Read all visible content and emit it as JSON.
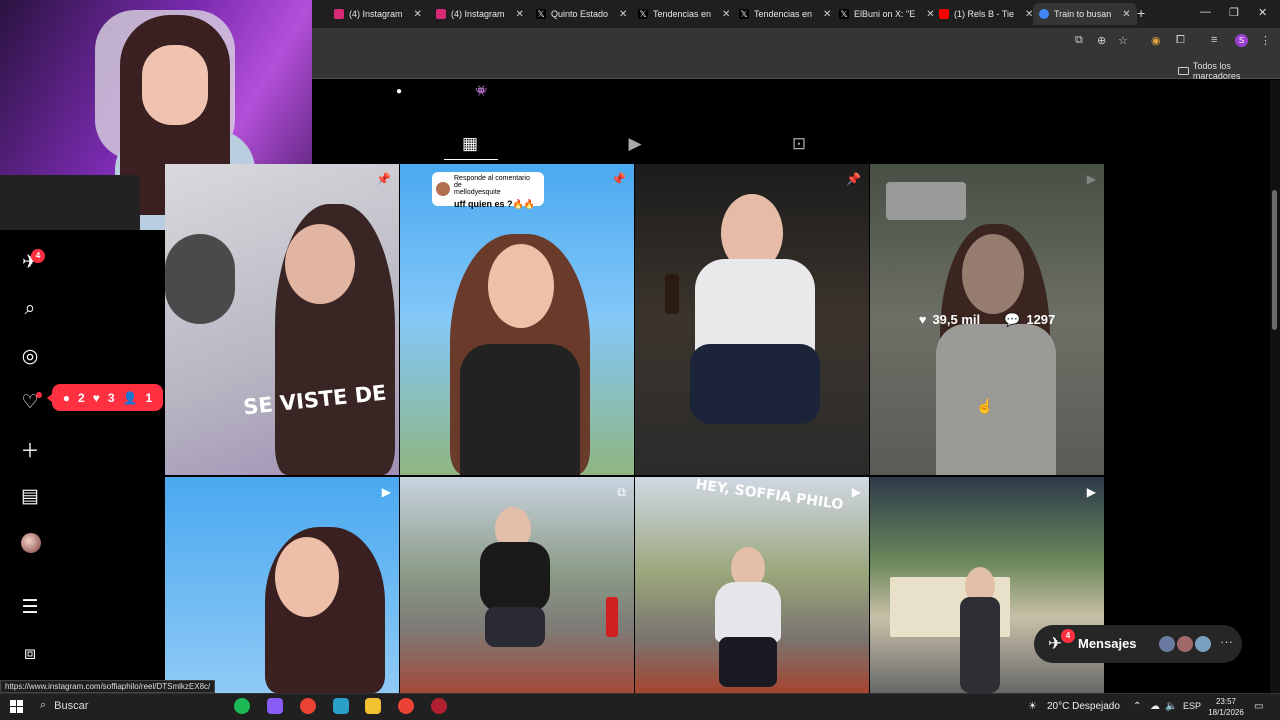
{
  "browser": {
    "tabs": [
      {
        "title": "(4) Instagram",
        "color": "#d62976"
      },
      {
        "title": "(4) Instagram",
        "color": "#d62976"
      },
      {
        "title": "Quinto Estado",
        "color": "#000000"
      },
      {
        "title": "Tendencias en",
        "color": "#000000"
      },
      {
        "title": "Tendencias en",
        "color": "#000000"
      },
      {
        "title": "ElBuni on X: \"E",
        "color": "#000000"
      },
      {
        "title": "(1) Rels B - Tie",
        "color": "#ff0000"
      },
      {
        "title": "Train to busan",
        "color": "#4285f4"
      }
    ],
    "bookmarks_all": "Todos los marcadores",
    "profile_initial": "S",
    "status_url": "https://www.instagram.com/soffiaphilo/reel/DTSmlkzEX8c/"
  },
  "nav": {
    "messages_badge": "4",
    "notifications": {
      "comments": "2",
      "likes": "3",
      "follows": "1"
    }
  },
  "grid": {
    "hover_stats": {
      "likes": "39,5 mil",
      "comments": "1297"
    },
    "comment_card": {
      "line1": "Responde al comentario de",
      "line2": "mellodyesquite",
      "text": "uff quien es ?🔥🔥"
    },
    "caption_1": "SE VISTE DE",
    "caption_2": "HEY, SOFFIA PHILO"
  },
  "messages": {
    "label": "Mensajes",
    "badge": "4"
  },
  "taskbar": {
    "search": "Buscar",
    "weather": "20°C  Despejado",
    "lang": "ESP",
    "time": "23:57",
    "date": "18/1/2026"
  }
}
